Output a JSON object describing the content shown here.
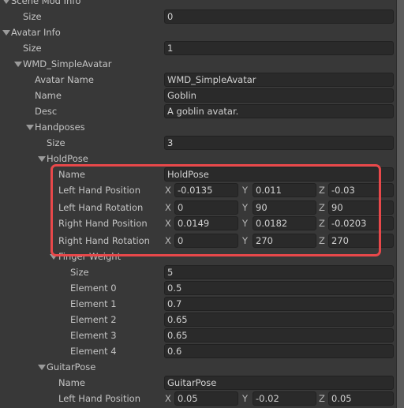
{
  "highlight_color": "#e8484a",
  "rows": [
    {
      "label": "Scene Mod Info",
      "indent": 0,
      "foldout": true
    },
    {
      "label": "Size",
      "indent": 1,
      "value": "0"
    },
    {
      "label": "Avatar Info",
      "indent": 0,
      "foldout": true
    },
    {
      "label": "Size",
      "indent": 1,
      "value": "1"
    },
    {
      "label": "WMD_SimpleAvatar",
      "indent": 1,
      "foldout": true
    },
    {
      "label": "Avatar Name",
      "indent": 2,
      "value": "WMD_SimpleAvatar"
    },
    {
      "label": "Name",
      "indent": 2,
      "value": "Goblin"
    },
    {
      "label": "Desc",
      "indent": 2,
      "value": "A goblin avatar."
    },
    {
      "label": "Handposes",
      "indent": 2,
      "foldout": true
    },
    {
      "label": "Size",
      "indent": 3,
      "value": "3"
    },
    {
      "label": "HoldPose",
      "indent": 3,
      "foldout": true
    },
    {
      "label": "Name",
      "indent": 4,
      "value": "HoldPose"
    },
    {
      "label": "Left Hand Position",
      "indent": 4,
      "vector": {
        "x": "-0.0135",
        "y": "0.011",
        "z": "-0.03"
      }
    },
    {
      "label": "Left Hand Rotation",
      "indent": 4,
      "vector": {
        "x": "0",
        "y": "90",
        "z": "90"
      }
    },
    {
      "label": "Right Hand Position",
      "indent": 4,
      "vector": {
        "x": "0.0149",
        "y": "0.0182",
        "z": "-0.0203"
      }
    },
    {
      "label": "Right Hand Rotation",
      "indent": 4,
      "vector": {
        "x": "0",
        "y": "270",
        "z": "270"
      }
    },
    {
      "label": "Finger Weight",
      "indent": 4,
      "foldout": true
    },
    {
      "label": "Size",
      "indent": 5,
      "value": "5"
    },
    {
      "label": "Element 0",
      "indent": 5,
      "value": "0.5"
    },
    {
      "label": "Element 1",
      "indent": 5,
      "value": "0.7"
    },
    {
      "label": "Element 2",
      "indent": 5,
      "value": "0.65"
    },
    {
      "label": "Element 3",
      "indent": 5,
      "value": "0.65"
    },
    {
      "label": "Element 4",
      "indent": 5,
      "value": "0.6"
    },
    {
      "label": "GuitarPose",
      "indent": 3,
      "foldout": true
    },
    {
      "label": "Name",
      "indent": 4,
      "value": "GuitarPose"
    },
    {
      "label": "Left Hand Position",
      "indent": 4,
      "vector": {
        "x": "0.05",
        "y": "-0.02",
        "z": "0.05"
      }
    }
  ],
  "axis_labels": {
    "x": "X",
    "y": "Y",
    "z": "Z"
  }
}
